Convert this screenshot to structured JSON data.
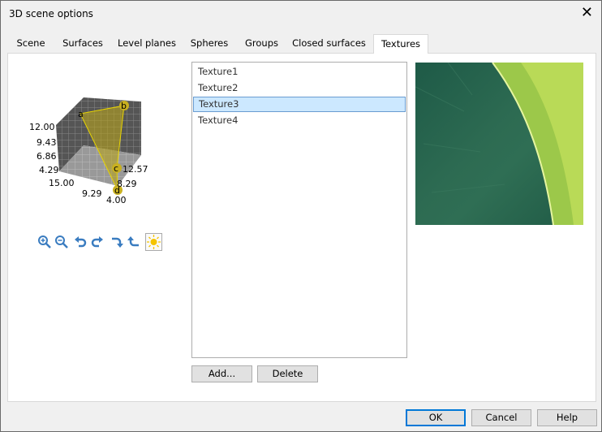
{
  "window": {
    "title": "3D scene options"
  },
  "tabs": [
    {
      "label": "Scene"
    },
    {
      "label": "Surfaces"
    },
    {
      "label": "Level planes"
    },
    {
      "label": "Spheres"
    },
    {
      "label": "Groups"
    },
    {
      "label": "Closed surfaces"
    },
    {
      "label": "Textures",
      "active": true
    }
  ],
  "preview": {
    "z_ticks": [
      "12.00",
      "9.43",
      "6.86",
      "4.29"
    ],
    "x_ticks": [
      "15.00",
      "9.29",
      "4.00"
    ],
    "y_ticks": [
      "12.57",
      "8.29"
    ],
    "points": [
      "a",
      "b",
      "c",
      "d"
    ],
    "toolbar": [
      "zoom-in-icon",
      "zoom-out-icon",
      "rotate-left-icon",
      "rotate-right-icon",
      "tilt-down-icon",
      "tilt-up-icon",
      "light-icon"
    ]
  },
  "textures": {
    "items": [
      "Texture1",
      "Texture2",
      "Texture3",
      "Texture4"
    ],
    "selected": "Texture3",
    "add_label": "Add...",
    "delete_label": "Delete"
  },
  "footer": {
    "ok": "OK",
    "cancel": "Cancel",
    "help": "Help"
  }
}
